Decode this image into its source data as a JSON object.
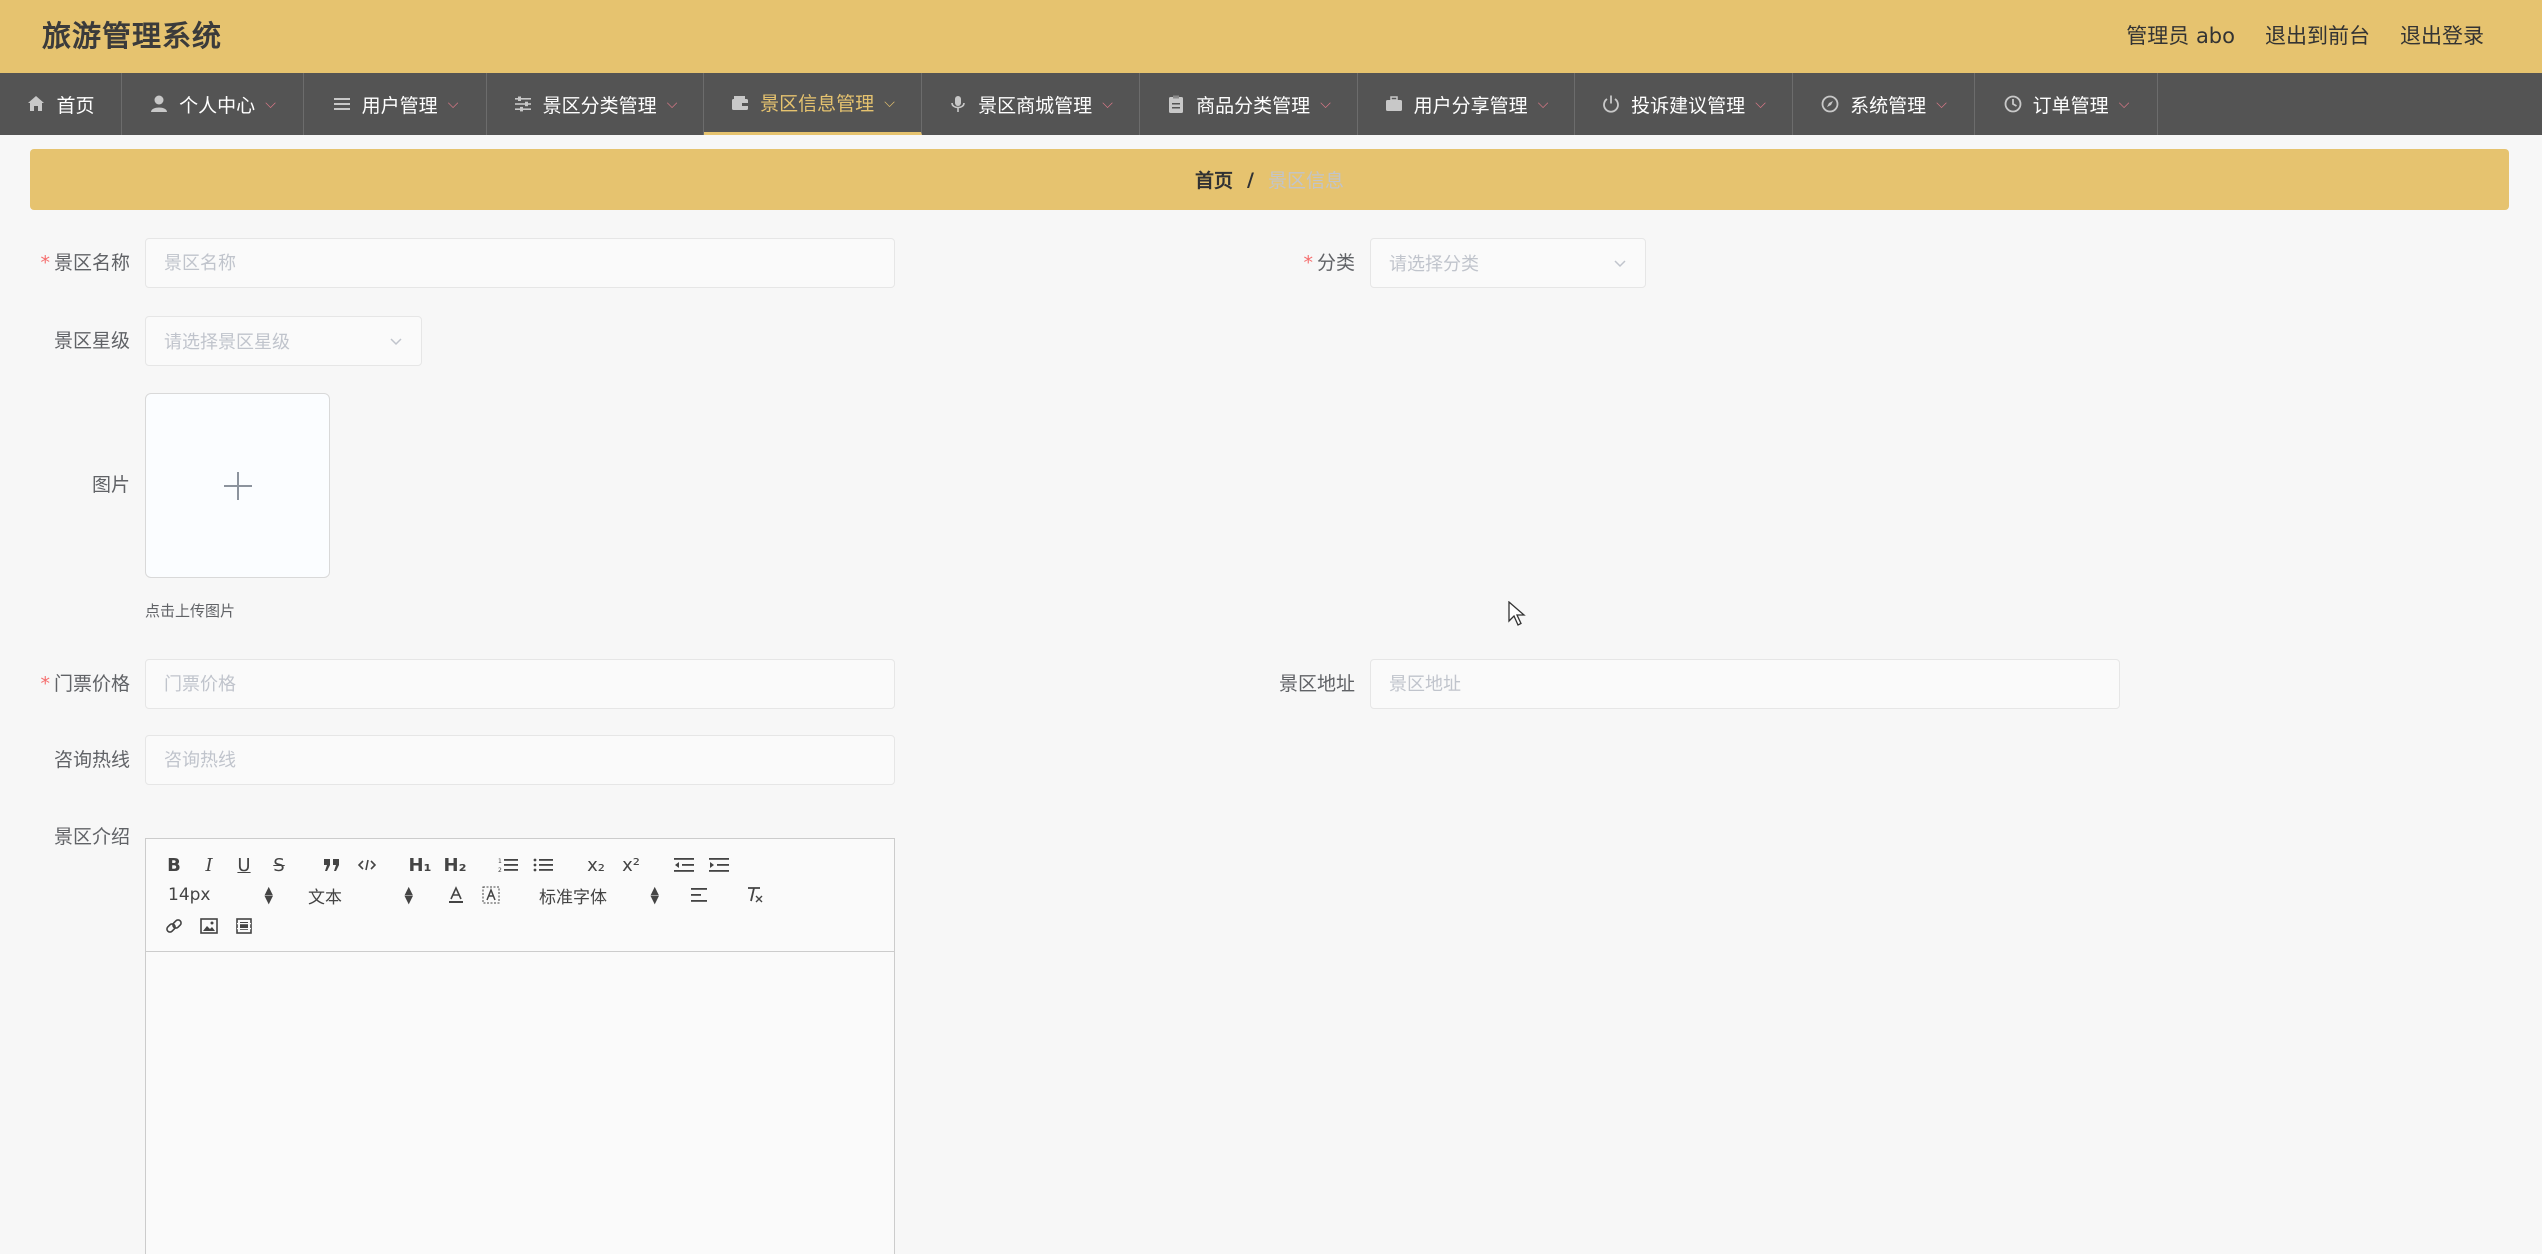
{
  "app": {
    "title": "旅游管理系统"
  },
  "header": {
    "admin": "管理员 abo",
    "to_front": "退出到前台",
    "logout": "退出登录"
  },
  "nav": [
    {
      "label": "首页",
      "icon": "home-icon",
      "dropdown": false,
      "active": false
    },
    {
      "label": "个人中心",
      "icon": "user-icon",
      "dropdown": true,
      "active": false
    },
    {
      "label": "用户管理",
      "icon": "list-icon",
      "dropdown": true,
      "active": false
    },
    {
      "label": "景区分类管理",
      "icon": "sliders-icon",
      "dropdown": true,
      "active": false
    },
    {
      "label": "景区信息管理",
      "icon": "wallet-icon",
      "dropdown": true,
      "active": true
    },
    {
      "label": "景区商城管理",
      "icon": "microphone-icon",
      "dropdown": true,
      "active": false
    },
    {
      "label": "商品分类管理",
      "icon": "clipboard-icon",
      "dropdown": true,
      "active": false
    },
    {
      "label": "用户分享管理",
      "icon": "briefcase-icon",
      "dropdown": true,
      "active": false
    },
    {
      "label": "投诉建议管理",
      "icon": "power-icon",
      "dropdown": true,
      "active": false
    },
    {
      "label": "系统管理",
      "icon": "compass-icon",
      "dropdown": true,
      "active": false
    },
    {
      "label": "订单管理",
      "icon": "clock-icon",
      "dropdown": true,
      "active": false
    }
  ],
  "breadcrumb": {
    "home": "首页",
    "separator": "/",
    "current": "景区信息"
  },
  "form": {
    "name": {
      "label": "景区名称",
      "placeholder": "景区名称",
      "value": ""
    },
    "category": {
      "label": "分类",
      "placeholder": "请选择分类"
    },
    "stars": {
      "label": "景区星级",
      "placeholder": "请选择景区星级"
    },
    "image": {
      "label": "图片",
      "tip": "点击上传图片"
    },
    "price": {
      "label": "门票价格",
      "placeholder": "门票价格",
      "value": ""
    },
    "address": {
      "label": "景区地址",
      "placeholder": "景区地址",
      "value": ""
    },
    "hotline": {
      "label": "咨询热线",
      "placeholder": "咨询热线",
      "value": ""
    },
    "intro": {
      "label": "景区介绍"
    }
  },
  "editor": {
    "size": "14px",
    "header": "文本",
    "font": "标准字体",
    "glyphs": {
      "bold": "B",
      "italic": "I",
      "underline": "U",
      "strike": "S",
      "h1": "H₁",
      "h2": "H₂",
      "sub": "x₂",
      "sup": "x²"
    }
  },
  "colors": {
    "header_bg": "#e6c36f",
    "nav_bg": "#545454",
    "accent": "#e6c36f",
    "required": "#f56c6c"
  }
}
